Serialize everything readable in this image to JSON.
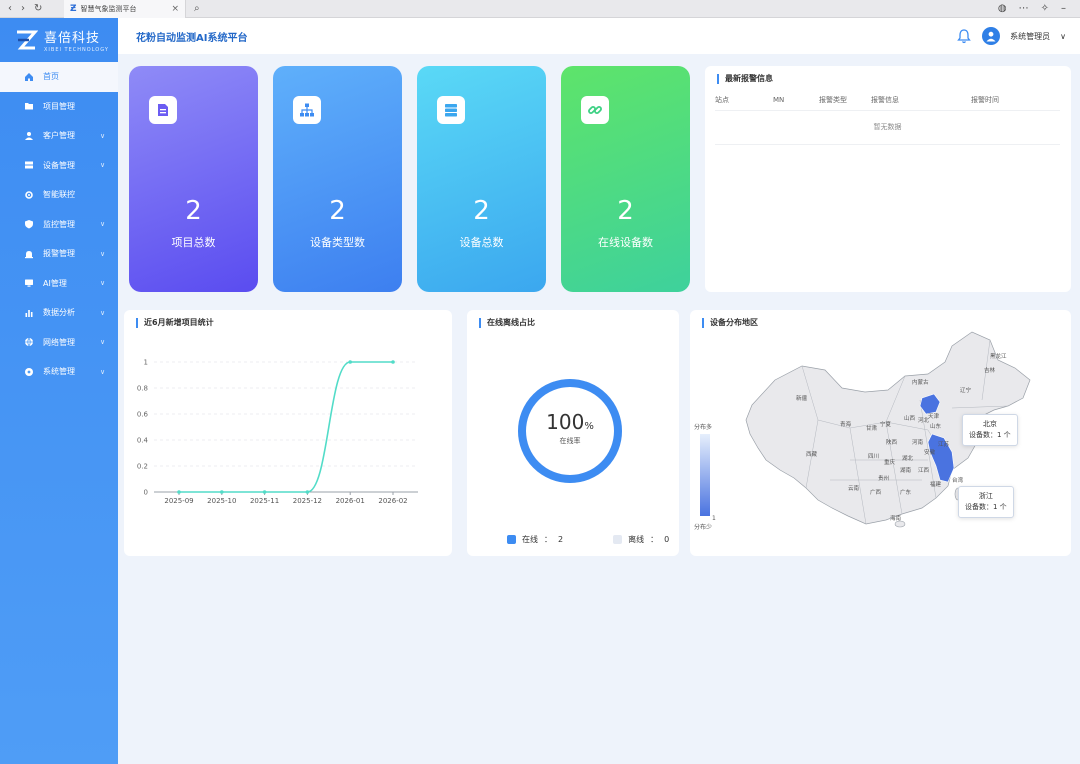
{
  "browser": {
    "tab_title": "智慧气象监测平台",
    "tab_close": "×",
    "nav_back": "‹",
    "nav_forward": "›",
    "nav_reload": "↻",
    "search_glyph": "⌕",
    "right_icons": [
      "globe-icon",
      "more-icon",
      "extensions-icon",
      "minimize-icon"
    ]
  },
  "brand": {
    "name": "喜倍科技",
    "tagline": "XIBEI TECHNOLOGY"
  },
  "header": {
    "title": "花粉自动监测AI系统平台",
    "user_name": "系统管理员",
    "user_chevron": "∨"
  },
  "sidebar": {
    "items": [
      {
        "label": "首页",
        "icon": "home-icon",
        "active": true,
        "has_children": false
      },
      {
        "label": "项目管理",
        "icon": "folder-icon",
        "active": false,
        "has_children": false
      },
      {
        "label": "客户管理",
        "icon": "user-icon",
        "active": false,
        "has_children": true
      },
      {
        "label": "设备管理",
        "icon": "server-icon",
        "active": false,
        "has_children": true
      },
      {
        "label": "智能联控",
        "icon": "gear-icon",
        "active": false,
        "has_children": false
      },
      {
        "label": "监控管理",
        "icon": "shield-icon",
        "active": false,
        "has_children": true
      },
      {
        "label": "报警管理",
        "icon": "alarm-icon",
        "active": false,
        "has_children": true
      },
      {
        "label": "AI管理",
        "icon": "monitor-icon",
        "active": false,
        "has_children": true
      },
      {
        "label": "数据分析",
        "icon": "bar-chart-icon",
        "active": false,
        "has_children": true
      },
      {
        "label": "网络管理",
        "icon": "network-icon",
        "active": false,
        "has_children": true
      },
      {
        "label": "系统管理",
        "icon": "settings-icon",
        "active": false,
        "has_children": true
      }
    ],
    "chevron": "∨"
  },
  "stats": [
    {
      "value": "2",
      "label": "项目总数",
      "icon": "document-icon"
    },
    {
      "value": "2",
      "label": "设备类型数",
      "icon": "hierarchy-icon"
    },
    {
      "value": "2",
      "label": "设备总数",
      "icon": "storage-icon"
    },
    {
      "value": "2",
      "label": "在线设备数",
      "icon": "link-icon"
    }
  ],
  "alarms": {
    "title": "最新报警信息",
    "columns": [
      "站点",
      "MN",
      "报警类型",
      "报警信息",
      "报警时间"
    ],
    "empty_text": "暂无数据"
  },
  "colors": {
    "accent": "#3d8cf2",
    "line": "#52dcc8",
    "donut": "#3d8cf2",
    "map_highlight": "#4a73e0"
  },
  "chart_data": [
    {
      "type": "line",
      "title": "近6月新增项目统计",
      "categories": [
        "2025-09",
        "2025-10",
        "2025-11",
        "2025-12",
        "2026-01",
        "2026-02"
      ],
      "values": [
        0,
        0,
        0,
        0,
        1,
        1
      ],
      "yticks": [
        "0",
        "0.2",
        "0.4",
        "0.6",
        "0.8",
        "1"
      ],
      "ylim": [
        0,
        1
      ],
      "smooth": true,
      "grid": true
    },
    {
      "type": "pie",
      "title": "在线离线占比",
      "labels": [
        "在线",
        "离线"
      ],
      "values": [
        2,
        0
      ],
      "center_value": "100",
      "center_unit": "%",
      "center_label": "在线率",
      "legend_position": "bottom"
    }
  ],
  "map": {
    "title": "设备分布地区",
    "legend_high": "分布多",
    "legend_low": "分布少",
    "legend_low_value": "1",
    "provinces": [
      "黑龙江",
      "吉林",
      "辽宁",
      "内蒙古",
      "新疆",
      "西藏",
      "青海",
      "甘肃",
      "宁夏",
      "陕西",
      "山西",
      "河北",
      "北京",
      "天津",
      "山东",
      "河南",
      "湖北",
      "安徽",
      "江苏",
      "浙江",
      "四川",
      "重庆",
      "湖南",
      "江西",
      "福建",
      "贵州",
      "云南",
      "广西",
      "广东",
      "海南",
      "台湾"
    ],
    "highlighted": [
      "北京",
      "浙江"
    ],
    "tooltips": [
      {
        "name": "北京",
        "text": "设备数：1 个"
      },
      {
        "name": "浙江",
        "text": "设备数：1 个"
      }
    ]
  }
}
